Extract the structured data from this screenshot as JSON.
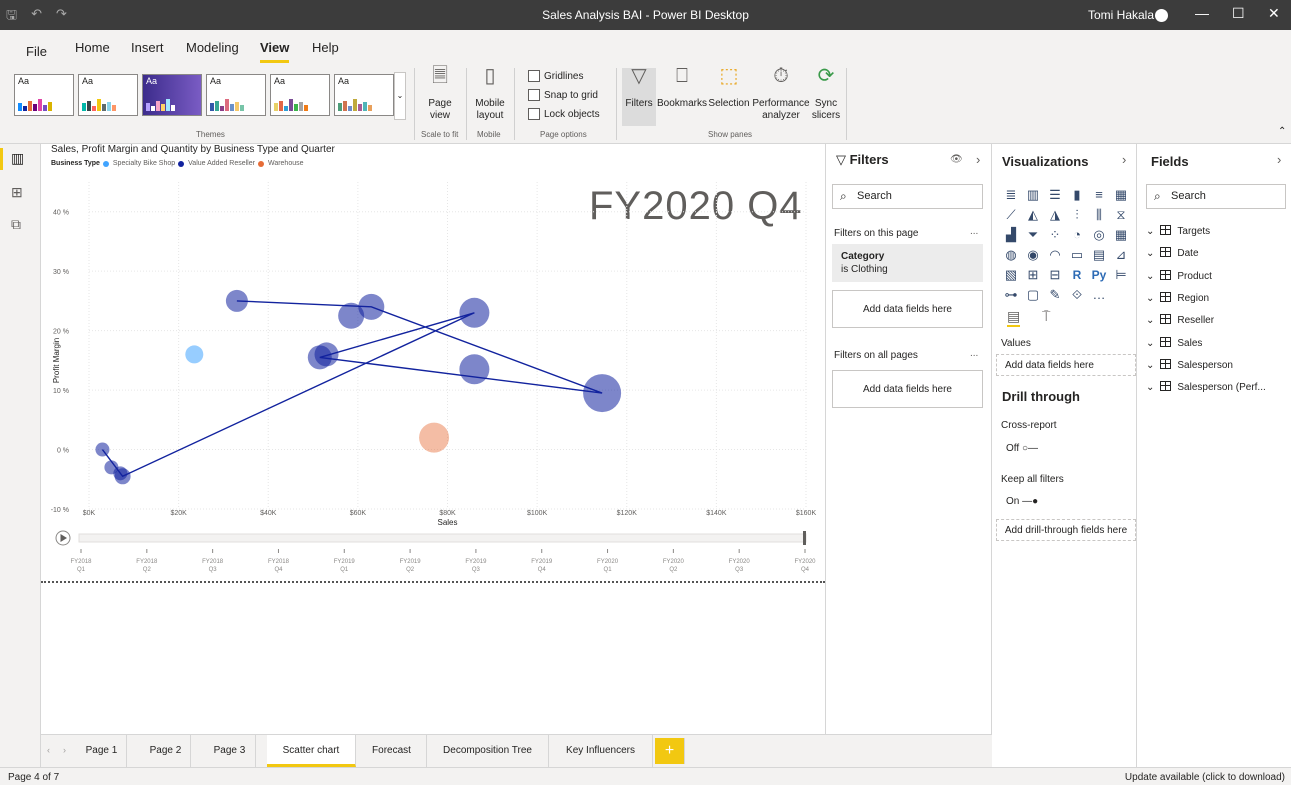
{
  "window": {
    "title": "Sales Analysis BAI - Power BI Desktop",
    "user": "Tomi Hakala",
    "minimize": "—",
    "maximize": "☐",
    "close": "✕"
  },
  "menu": {
    "file": "File",
    "home": "Home",
    "insert": "Insert",
    "modeling": "Modeling",
    "view": "View",
    "help": "Help"
  },
  "ribbon": {
    "themes_label": "Themes",
    "theme_aa": "Aa",
    "page_view": "Page view",
    "scale_to_fit": "Scale to fit",
    "mobile_layout": "Mobile layout",
    "mobile": "Mobile",
    "gridlines": "Gridlines",
    "snap_to_grid": "Snap to grid",
    "lock_objects": "Lock objects",
    "page_options": "Page options",
    "filters": "Filters",
    "bookmarks": "Bookmarks",
    "selection": "Selection",
    "performance_analyzer": "Performance analyzer",
    "sync_slicers": "Sync slicers",
    "show_panes": "Show panes"
  },
  "visual": {
    "title": "Sales, Profit Margin and Quantity by Business Type and Quarter",
    "legend_title": "Business Type",
    "play_label": "FY2020 Q4",
    "colors": {
      "specialty": "#41a4ff",
      "value_added": "#12239e",
      "warehouse": "#e66c37"
    }
  },
  "chart_data": {
    "type": "scatter",
    "title": "Sales, Profit Margin and Quantity by Business Type and Quarter",
    "xlabel": "Sales",
    "ylabel": "Profit Margin",
    "xlim": [
      0,
      160000
    ],
    "ylim": [
      -10,
      45
    ],
    "x_ticks": [
      "$0K",
      "$20K",
      "$40K",
      "$60K",
      "$80K",
      "$100K",
      "$120K",
      "$140K",
      "$160K"
    ],
    "y_ticks": [
      "-10 %",
      "0 %",
      "10 %",
      "20 %",
      "30 %",
      "40 %"
    ],
    "legend": "top-left",
    "series": [
      {
        "name": "Specialty Bike Shop",
        "points": [
          {
            "x": 23500,
            "y": 16,
            "size": 18
          }
        ]
      },
      {
        "name": "Value Added Reseller",
        "points": [
          {
            "x": 3000,
            "y": 0,
            "size": 14
          },
          {
            "x": 5000,
            "y": -3,
            "size": 14
          },
          {
            "x": 7000,
            "y": -4,
            "size": 14
          },
          {
            "x": 7500,
            "y": -4.5,
            "size": 16
          },
          {
            "x": 33000,
            "y": 25,
            "size": 22
          },
          {
            "x": 51500,
            "y": 15.5,
            "size": 24
          },
          {
            "x": 53000,
            "y": 16,
            "size": 24
          },
          {
            "x": 58500,
            "y": 22.5,
            "size": 26
          },
          {
            "x": 63000,
            "y": 24,
            "size": 26
          },
          {
            "x": 86000,
            "y": 13.5,
            "size": 30
          },
          {
            "x": 86000,
            "y": 23,
            "size": 30
          },
          {
            "x": 114500,
            "y": 9.5,
            "size": 38
          }
        ]
      },
      {
        "name": "Warehouse",
        "points": [
          {
            "x": 77000,
            "y": 2,
            "size": 30
          }
        ]
      }
    ],
    "trail": [
      {
        "x": 3000,
        "y": 0
      },
      {
        "x": 7500,
        "y": -4.5
      },
      {
        "x": 86000,
        "y": 23
      },
      {
        "x": 51500,
        "y": 15.5
      },
      {
        "x": 114500,
        "y": 9.5
      },
      {
        "x": 63000,
        "y": 24
      },
      {
        "x": 33000,
        "y": 25
      }
    ],
    "play_axis": {
      "labels": [
        [
          "FY2018",
          "Q1"
        ],
        [
          "FY2018",
          "Q2"
        ],
        [
          "FY2018",
          "Q3"
        ],
        [
          "FY2018",
          "Q4"
        ],
        [
          "FY2019",
          "Q1"
        ],
        [
          "FY2019",
          "Q2"
        ],
        [
          "FY2019",
          "Q3"
        ],
        [
          "FY2019",
          "Q4"
        ],
        [
          "FY2020",
          "Q1"
        ],
        [
          "FY2020",
          "Q2"
        ],
        [
          "FY2020",
          "Q3"
        ],
        [
          "FY2020",
          "Q4"
        ]
      ],
      "current": "FY2020 Q4"
    }
  },
  "filters_pane": {
    "title": "Filters",
    "search_placeholder": "Search",
    "on_this_page": "Filters on this page",
    "card_title": "Category",
    "card_value": "is Clothing",
    "add_fields": "Add data fields here",
    "on_all_pages": "Filters on all pages",
    "add_fields_all": "Add data fields here",
    "more": "..."
  },
  "viz_pane": {
    "title": "Visualizations",
    "values_label": "Values",
    "add_data": "Add data fields here",
    "drill_through": "Drill through",
    "cross_report": "Cross-report",
    "off": "Off",
    "keep_filters": "Keep all filters",
    "on": "On",
    "add_drill": "Add drill-through fields here",
    "icons": [
      "stacked-bar",
      "stacked-column",
      "clustered-bar",
      "clustered-column",
      "100-bar",
      "100-column",
      "line",
      "area",
      "stacked-area",
      "line-column",
      "line-clustered",
      "ribbon",
      "waterfall",
      "funnel",
      "scatter",
      "pie",
      "donut",
      "treemap",
      "map",
      "filled-map",
      "gauge",
      "card",
      "multi-row-card",
      "kpi",
      "slicer",
      "table",
      "matrix",
      "R",
      "Py",
      "key-influencers",
      "decomposition",
      "qa",
      "smart-narrative",
      "paginated",
      "more"
    ]
  },
  "fields_pane": {
    "title": "Fields",
    "search_placeholder": "Search",
    "tables": [
      "Targets",
      "Date",
      "Product",
      "Region",
      "Reseller",
      "Sales",
      "Salesperson",
      "Salesperson (Perf..."
    ]
  },
  "tabs": [
    "Page 1",
    "Page 2",
    "Page 3",
    "Scatter chart",
    "Forecast",
    "Decomposition Tree",
    "Key Influencers"
  ],
  "active_tab": "Scatter chart",
  "add_tab": "+",
  "status": {
    "page": "Page 4 of 7",
    "update": "Update available (click to download)"
  }
}
